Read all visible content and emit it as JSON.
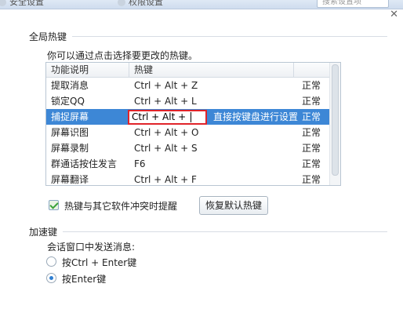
{
  "topbar": {
    "tabs": [
      {
        "label": "安全设置"
      },
      {
        "label": "权限设置"
      }
    ],
    "search_placeholder": "搜索设置项"
  },
  "hotkeys": {
    "group_title": "全局热键",
    "hint": "你可以通过点击选择要更改的热键。",
    "columns": [
      "功能说明",
      "热键"
    ],
    "rows": [
      {
        "name": "提取消息",
        "key": "Ctrl + Alt + Z",
        "status": "正常"
      },
      {
        "name": "锁定QQ",
        "key": "Ctrl + Alt + L",
        "status": "正常"
      },
      {
        "name": "捕捉屏幕",
        "key": "Ctrl + Alt + ",
        "status": "正常",
        "tip": "直接按键盘进行设置",
        "selected": true
      },
      {
        "name": "屏幕识图",
        "key": "Ctrl + Alt + O",
        "status": "正常"
      },
      {
        "name": "屏幕录制",
        "key": "Ctrl + Alt + S",
        "status": "正常"
      },
      {
        "name": "群通话按住发言",
        "key": "F6",
        "status": "正常"
      },
      {
        "name": "屏幕翻译",
        "key": "Ctrl + Alt + F",
        "status": "正常"
      }
    ],
    "conflict_checkbox": {
      "label": "热键与其它软件冲突时提醒",
      "checked": true
    },
    "restore_button": "恢复默认热键"
  },
  "accelerator": {
    "group_title": "加速键",
    "send_label": "会话窗口中发送消息:",
    "options": [
      {
        "label": "按Ctrl + Enter键",
        "checked": false
      },
      {
        "label": "按Enter键",
        "checked": true
      }
    ]
  },
  "colors": {
    "selection": "#3d87d6",
    "highlight_border": "#e0242a"
  }
}
